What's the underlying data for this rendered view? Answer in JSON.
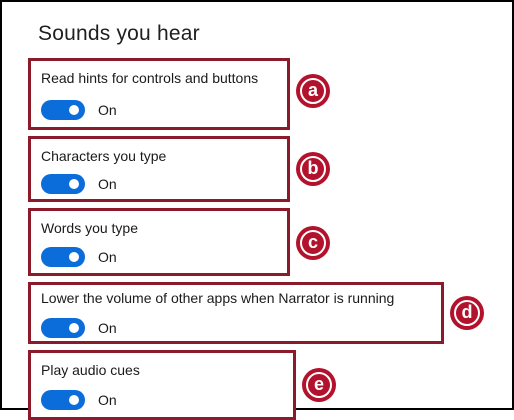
{
  "section": {
    "heading": "Sounds you hear"
  },
  "settings": [
    {
      "label": "Read hints for controls and buttons",
      "toggle_state": "On",
      "marker": "a"
    },
    {
      "label": "Characters you type",
      "toggle_state": "On",
      "marker": "b"
    },
    {
      "label": "Words you type",
      "toggle_state": "On",
      "marker": "c"
    },
    {
      "label": "Lower the volume of other apps when Narrator is running",
      "toggle_state": "On",
      "marker": "d"
    },
    {
      "label": "Play audio cues",
      "toggle_state": "On",
      "marker": "e"
    }
  ],
  "colors": {
    "toggle_on": "#0a6dd9",
    "highlight_border": "#8b1a2b",
    "marker_fill": "#b3122c"
  },
  "icons": {
    "toggle": "toggle-switch-on-icon",
    "marker": "circled-letter-marker"
  }
}
